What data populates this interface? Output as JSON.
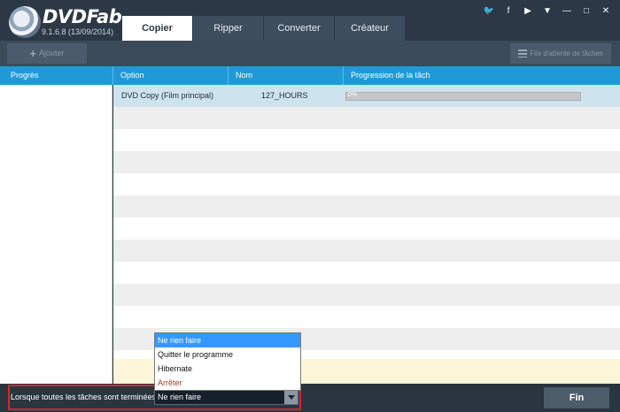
{
  "app": {
    "brand": "DVDFab",
    "version": "9.1.6.8 (13/09/2014)"
  },
  "tabs": [
    {
      "label": "Copier",
      "active": true
    },
    {
      "label": "Ripper",
      "active": false
    },
    {
      "label": "Converter",
      "active": false
    },
    {
      "label": "Créateur",
      "active": false
    }
  ],
  "window_controls": [
    {
      "icon": "twitter-icon",
      "glyph": "🐦"
    },
    {
      "icon": "facebook-icon",
      "glyph": "f"
    },
    {
      "icon": "youtube-icon",
      "glyph": "▶"
    },
    {
      "icon": "dropdown-menu-icon",
      "glyph": "▼"
    },
    {
      "icon": "minimize-icon",
      "glyph": "—"
    },
    {
      "icon": "maximize-icon",
      "glyph": "□"
    },
    {
      "icon": "close-icon",
      "glyph": "✕"
    }
  ],
  "toolbar": {
    "add_label": "Ajouter",
    "queue_label": "File d'attente de tâches"
  },
  "columns": {
    "progress": "Progrès",
    "option": "Option",
    "name": "Nom",
    "task_progress": "Progression de la tâch"
  },
  "task": {
    "option": "DVD Copy (Film principal)",
    "name": "127_HOURS",
    "progress_text": "0%",
    "progress": 0
  },
  "footer": {
    "label": "Lorsque toutes les tâches sont terminées:",
    "selected": "Ne rien faire",
    "options": [
      "Ne rien faire",
      "Quitter le programme",
      "Hibernate",
      "Arrêter"
    ],
    "fin_label": "Fin"
  },
  "colors": {
    "accent": "#1f9ad6",
    "selection": "#3399ff",
    "highlight_border": "#d9242b"
  }
}
